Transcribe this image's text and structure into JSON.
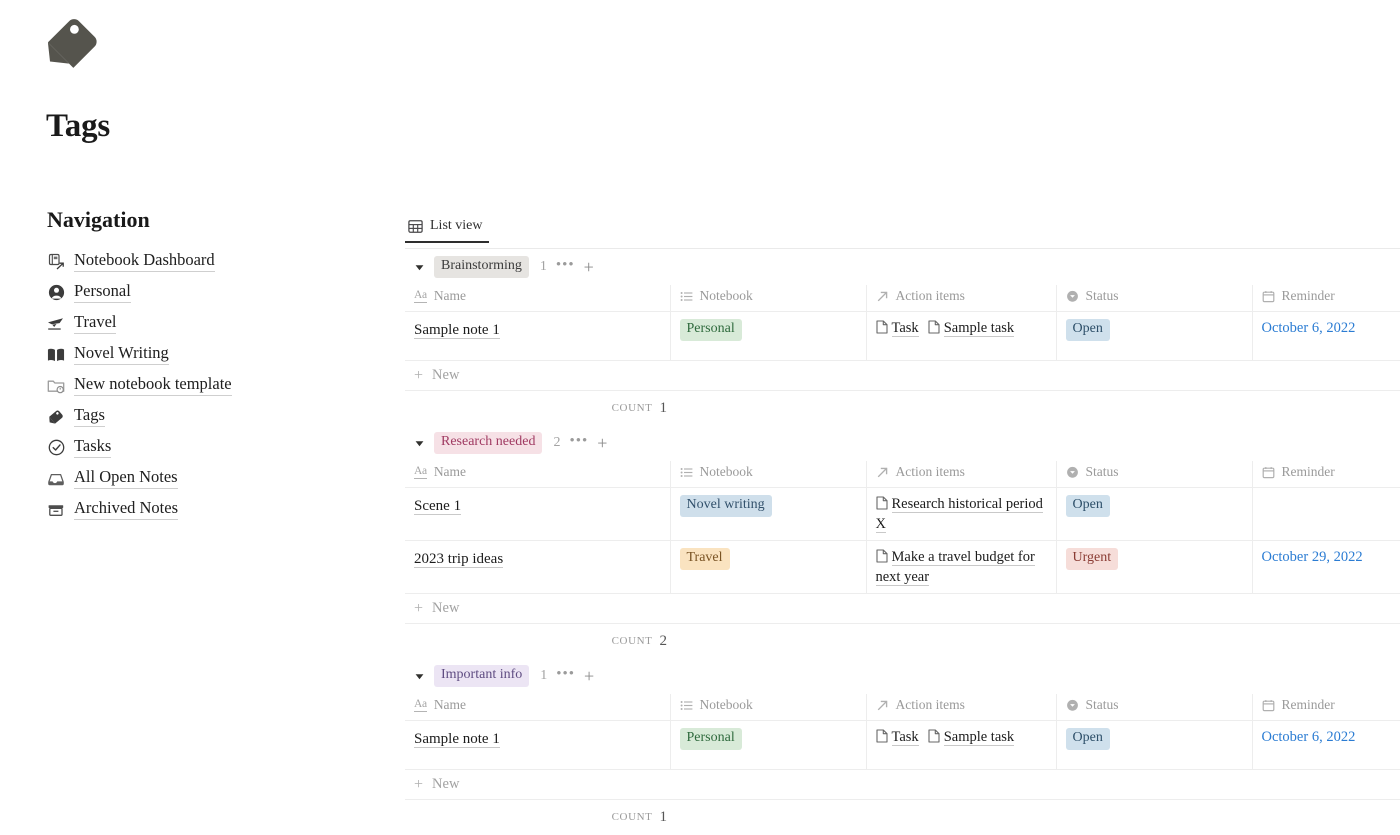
{
  "page": {
    "icon": "tag-icon",
    "title": "Tags"
  },
  "sidebar": {
    "heading": "Navigation",
    "items": [
      {
        "label": "Notebook Dashboard",
        "icon": "notebook-dashboard-icon"
      },
      {
        "label": "Personal",
        "icon": "person-icon"
      },
      {
        "label": "Travel",
        "icon": "airplane-icon"
      },
      {
        "label": "Novel Writing",
        "icon": "open-book-icon"
      },
      {
        "label": "New notebook template",
        "icon": "folder-clock-icon"
      },
      {
        "label": "Tags",
        "icon": "tag-icon"
      },
      {
        "label": "Tasks",
        "icon": "check-circle-icon"
      },
      {
        "label": "All Open Notes",
        "icon": "inbox-icon"
      },
      {
        "label": "Archived Notes",
        "icon": "archive-box-icon"
      }
    ]
  },
  "view": {
    "tab_label": "List view",
    "tab_icon": "table-grid-icon",
    "new_row_label": "New",
    "count_label": "COUNT",
    "group_menu_icon": "ellipsis-icon",
    "group_add_icon": "plus-icon",
    "collapse_icon": "caret-down-icon"
  },
  "columns": [
    {
      "label": "Name",
      "icon": "text-aa-icon"
    },
    {
      "label": "Notebook",
      "icon": "list-relation-icon"
    },
    {
      "label": "Action items",
      "icon": "arrow-up-right-icon"
    },
    {
      "label": "Status",
      "icon": "select-circle-icon"
    },
    {
      "label": "Reminder",
      "icon": "calendar-icon"
    }
  ],
  "colors": {
    "tag_gray_bg": "#e6e4e1",
    "tag_gray_text": "#3b3b3b",
    "tag_pink_bg": "#f6e1e6",
    "tag_pink_text": "#a03a62",
    "tag_purple_bg": "#ece5f4",
    "tag_purple_text": "#5f4c82",
    "green_bg": "#d8ead8",
    "green_text": "#2f6a3d",
    "blue_bg": "#cfdfeb",
    "blue_text": "#31506b",
    "orange_bg": "#fae3c0",
    "orange_text": "#7a5424",
    "status_open_bg": "#cfe0ec",
    "status_open_text": "#2d4f69",
    "status_urgent_bg": "#f6ddd9",
    "status_urgent_text": "#8a3b33",
    "date_link": "#2b7cd3"
  },
  "groups": [
    {
      "name": "Brainstorming",
      "pill_style": "gray",
      "count": "1",
      "count_value": "1",
      "rows": [
        {
          "name": "Sample note 1",
          "notebook": {
            "label": "Personal",
            "style": "green"
          },
          "action_items": [
            "Task",
            "Sample task"
          ],
          "status": {
            "label": "Open",
            "style": "open"
          },
          "reminder": "October 6, 2022"
        }
      ]
    },
    {
      "name": "Research needed",
      "pill_style": "pink",
      "count": "2",
      "count_value": "2",
      "rows": [
        {
          "name": "Scene 1",
          "notebook": {
            "label": "Novel writing",
            "style": "blue"
          },
          "action_items": [
            "Research historical period X"
          ],
          "status": {
            "label": "Open",
            "style": "open"
          },
          "reminder": ""
        },
        {
          "name": "2023 trip ideas",
          "notebook": {
            "label": "Travel",
            "style": "orange"
          },
          "action_items": [
            "Make a travel budget for next year"
          ],
          "status": {
            "label": "Urgent",
            "style": "urgent"
          },
          "reminder": "October 29, 2022"
        }
      ]
    },
    {
      "name": "Important info",
      "pill_style": "purple",
      "count": "1",
      "count_value": "1",
      "rows": [
        {
          "name": "Sample note 1",
          "notebook": {
            "label": "Personal",
            "style": "green"
          },
          "action_items": [
            "Task",
            "Sample task"
          ],
          "status": {
            "label": "Open",
            "style": "open"
          },
          "reminder": "October 6, 2022"
        }
      ]
    }
  ]
}
